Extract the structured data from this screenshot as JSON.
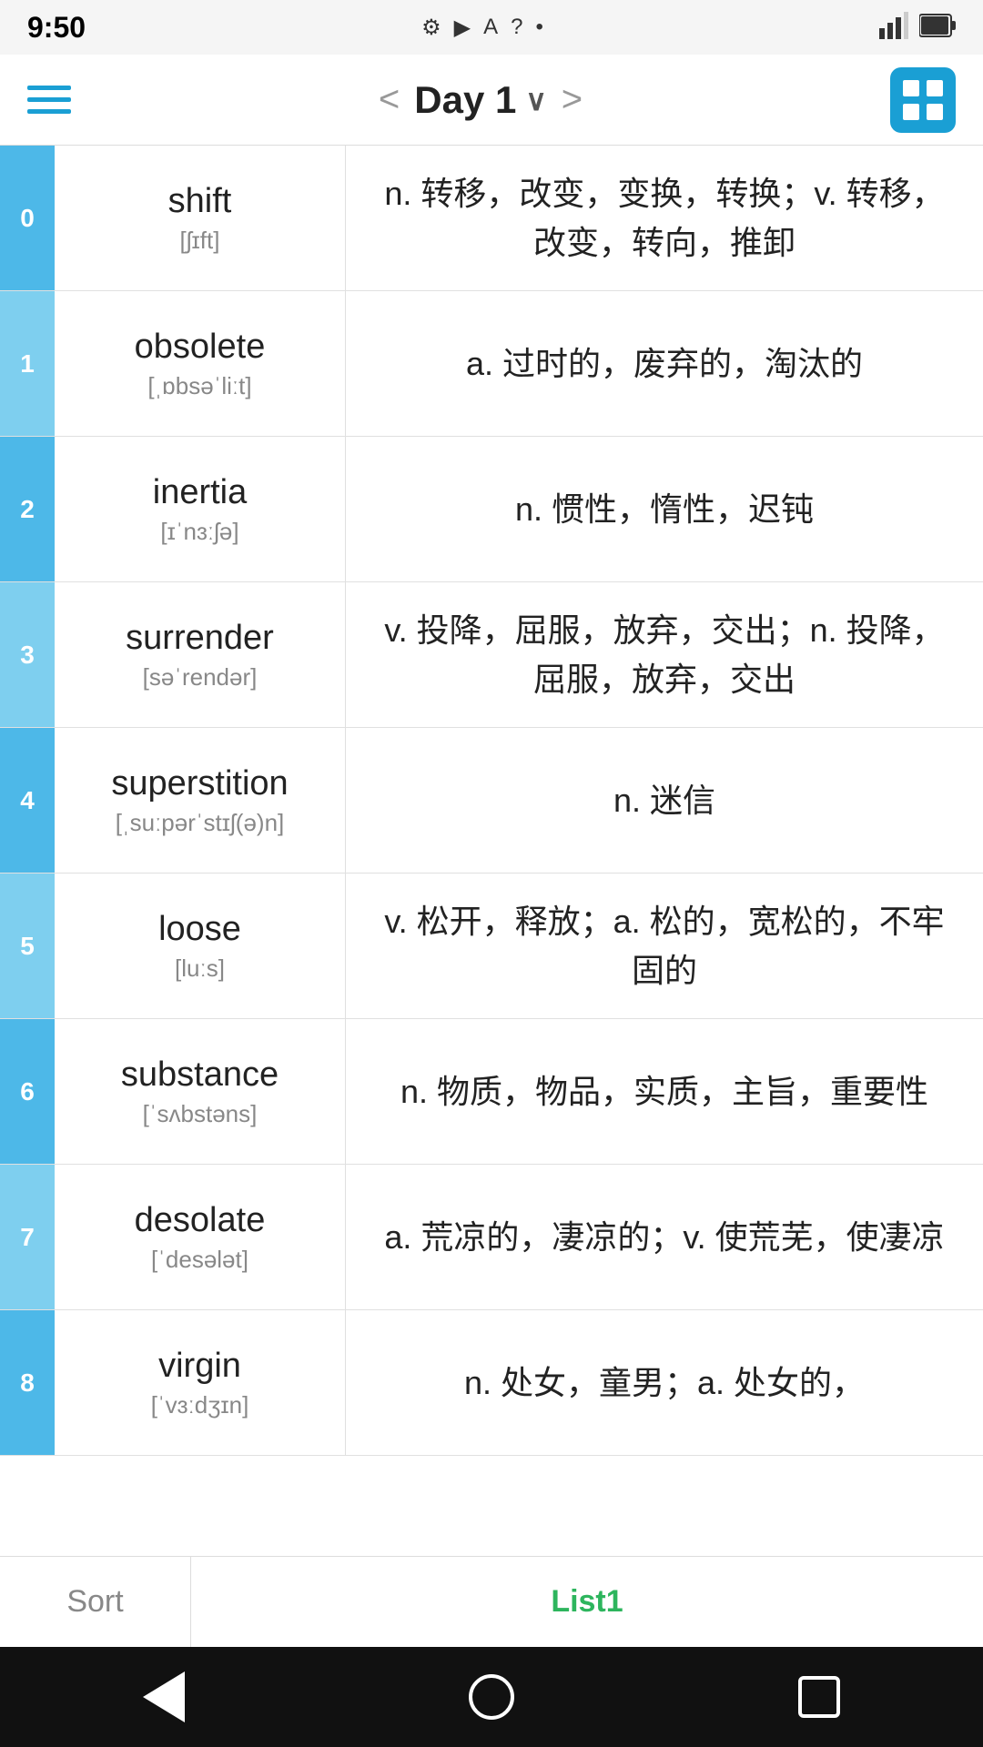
{
  "statusBar": {
    "time": "9:50",
    "icons": [
      "⚙",
      "▶",
      "A",
      "?",
      "•"
    ]
  },
  "topNav": {
    "title": "Day 1",
    "prevLabel": "<",
    "nextLabel": ">"
  },
  "words": [
    {
      "index": "0",
      "word": "shift",
      "phonetic": "[ʃɪft]",
      "chinese": "n. 转移，改变，变换，转换；v. 转移，改变，转向，推卸"
    },
    {
      "index": "1",
      "word": "obsolete",
      "phonetic": "[ˌɒbsəˈliːt]",
      "chinese": "a. 过时的，废弃的，淘汰的"
    },
    {
      "index": "2",
      "word": "inertia",
      "phonetic": "[ɪˈnɜːʃə]",
      "chinese": "n. 惯性，惰性，迟钝"
    },
    {
      "index": "3",
      "word": "surrender",
      "phonetic": "[səˈrendər]",
      "chinese": "v. 投降，屈服，放弃，交出；n. 投降，屈服，放弃，交出"
    },
    {
      "index": "4",
      "word": "superstition",
      "phonetic": "[ˌsuːpərˈstɪʃ(ə)n]",
      "chinese": "n. 迷信"
    },
    {
      "index": "5",
      "word": "loose",
      "phonetic": "[luːs]",
      "chinese": "v. 松开，释放；a. 松的，宽松的，不牢固的"
    },
    {
      "index": "6",
      "word": "substance",
      "phonetic": "[ˈsʌbstəns]",
      "chinese": "n. 物质，物品，实质，主旨，重要性"
    },
    {
      "index": "7",
      "word": "desolate",
      "phonetic": "[ˈdesələt]",
      "chinese": "a. 荒凉的，凄凉的；v. 使荒芜，使凄凉"
    },
    {
      "index": "8",
      "word": "virgin",
      "phonetic": "[ˈvɜːdʒɪn]",
      "chinese": "n. 处女，童男；a. 处女的，"
    }
  ],
  "bottomTabs": {
    "sort": "Sort",
    "list1": "List1"
  }
}
